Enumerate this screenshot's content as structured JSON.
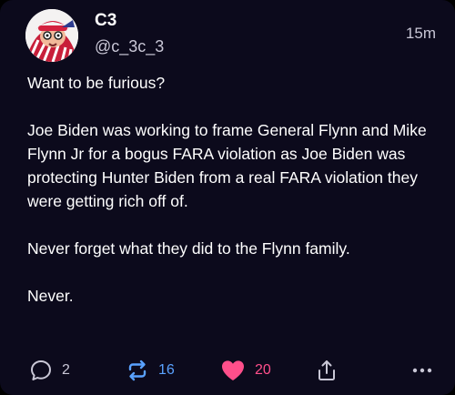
{
  "post": {
    "author": {
      "display_name": "C3",
      "handle": "@c_3c_3"
    },
    "time_ago": "15m",
    "paragraphs": [
      "Want to be furious?",
      "Joe Biden was working to frame General Flynn and Mike Flynn Jr for a bogus FARA violation as Joe Biden was protecting Hunter Biden from a real FARA violation they were getting rich off of.",
      "Never forget what they did to the Flynn family.",
      "Never."
    ]
  },
  "actions": {
    "reply_count": "2",
    "repost_count": "16",
    "like_count": "20",
    "icons": {
      "reply": "speech-bubble-icon",
      "repost": "repost-arrows-icon",
      "like": "heart-icon",
      "share": "share-up-arrow-icon",
      "more": "ellipsis-icon"
    }
  },
  "colors": {
    "background": "#0c0a1c",
    "text": "#ffffff",
    "muted": "#c9c7d6",
    "repost_active": "#5aa2ff",
    "like_active": "#ff4f8b"
  }
}
